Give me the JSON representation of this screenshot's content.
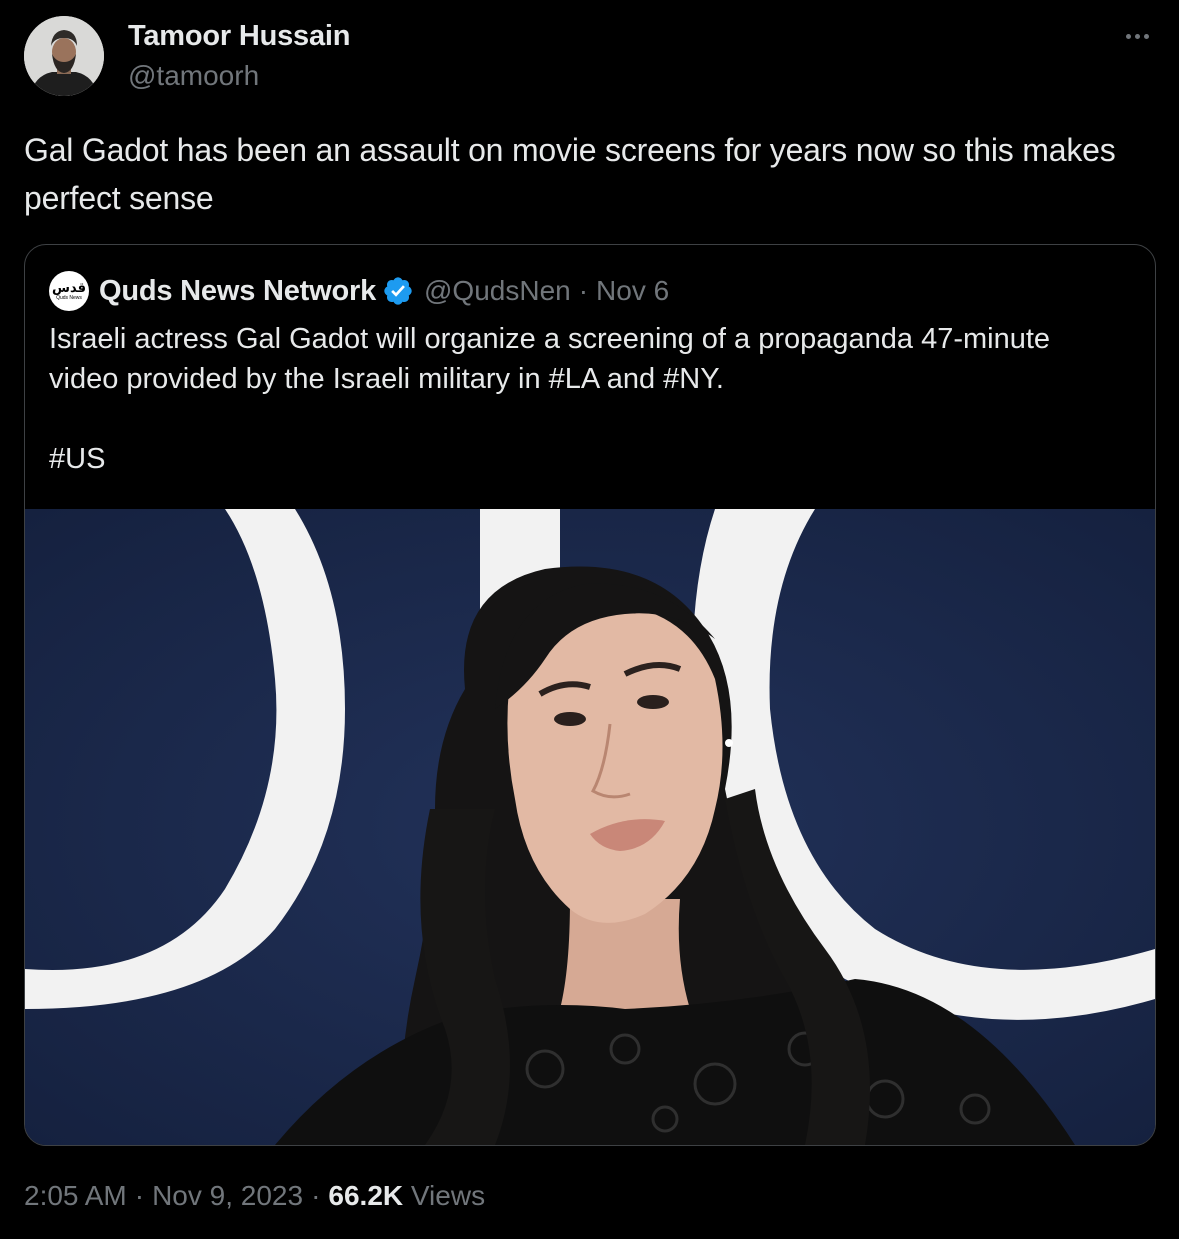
{
  "tweet": {
    "author": {
      "name": "Tamoor Hussain",
      "handle": "@tamoorh"
    },
    "more_icon": "more-horizontal-icon",
    "text": "Gal Gadot has been an assault on movie screens for years now so this makes perfect sense",
    "timestamp": {
      "time": "2:05 AM",
      "separator": "·",
      "date": "Nov 9, 2023",
      "views_count": "66.2K",
      "views_label": "Views"
    }
  },
  "quote": {
    "logo": {
      "arabic": "قدس",
      "english": "Quds News"
    },
    "name": "Quds News Network",
    "verified_icon": "verified-badge-icon",
    "handle": "@QudsNen",
    "separator": "·",
    "date": "Nov 6",
    "text_lines": [
      "Israeli actress Gal Gadot will organize a screening of a propaganda 47-minute",
      "video provided by the Israeli military in #LA and #NY.",
      "#US"
    ],
    "photo": {
      "background_color": "#1b2a4f",
      "letter_color": "#f2f2f2"
    }
  },
  "colors": {
    "background": "#000000",
    "primary_text": "#e7e9ea",
    "secondary_text": "#71767b",
    "verified": "#1d9bf0",
    "border": "#3e4144"
  }
}
